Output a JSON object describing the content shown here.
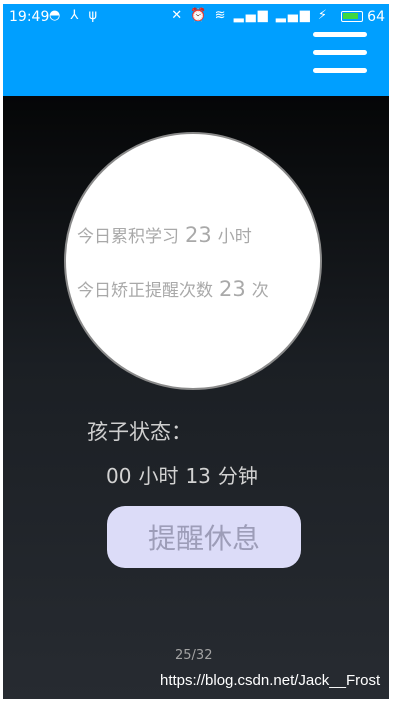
{
  "status_bar": {
    "time": "19:49",
    "icons_left": "◓ ⅄ ψ",
    "icons_right": "✕ ⏰ ≋ ▂▄▆ ▂▄▆ ⚡",
    "battery_percent": "64",
    "battery_level": 0.64,
    "battery_color": "#3fd83f"
  },
  "toolbar": {
    "color": "#009FFF",
    "menu_icon": "hamburger-menu-icon"
  },
  "stats": {
    "study_label": "今日累积学习",
    "study_value": "23",
    "study_unit": "小时",
    "correct_label": "今日矫正提醒次数",
    "correct_value": "23",
    "correct_unit": "次"
  },
  "child_state": {
    "label": "孩子状态：",
    "hours": "00",
    "hours_unit": "小时",
    "minutes": "13",
    "minutes_unit": "分钟"
  },
  "remind_button": {
    "label": "提醒休息"
  },
  "page_indicator": "25/32",
  "watermark": "https://blog.csdn.net/Jack__Frost"
}
